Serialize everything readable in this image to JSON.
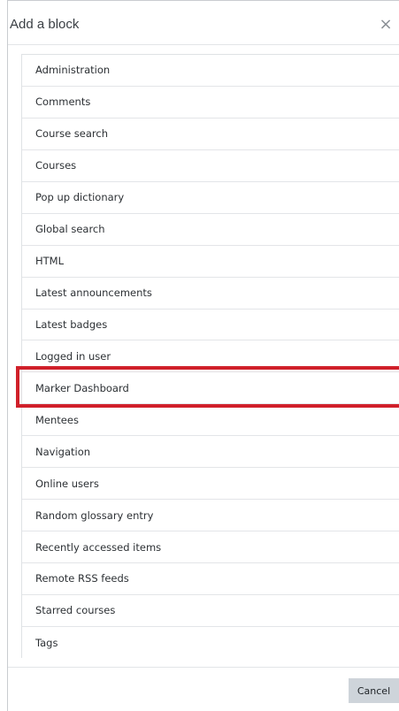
{
  "modal": {
    "title": "Add a block",
    "close_symbol": "×",
    "close_icon": "close-icon"
  },
  "blocks": [
    "Administration",
    "Comments",
    "Course search",
    "Courses",
    "Pop up dictionary",
    "Global search",
    "HTML",
    "Latest announcements",
    "Latest badges",
    "Logged in user",
    "Marker Dashboard",
    "Mentees",
    "Navigation",
    "Online users",
    "Random glossary entry",
    "Recently accessed items",
    "Remote RSS feeds",
    "Starred courses",
    "Tags"
  ],
  "highlighted_block": "Marker Dashboard",
  "footer": {
    "cancel_label": "Cancel"
  },
  "colors": {
    "highlight": "#d0202a",
    "cancel_button": "#ced4da"
  }
}
